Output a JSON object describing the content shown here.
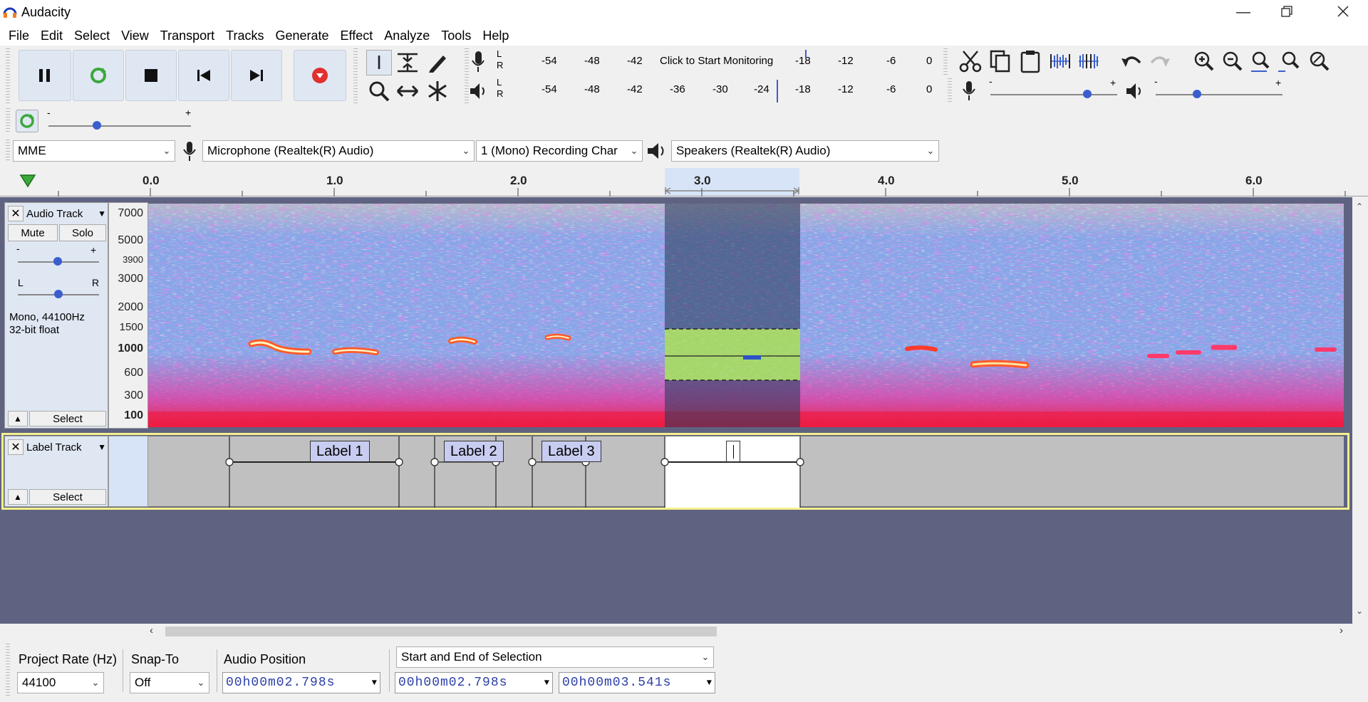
{
  "window": {
    "title": "Audacity"
  },
  "menu": [
    "File",
    "Edit",
    "Select",
    "View",
    "Transport",
    "Tracks",
    "Generate",
    "Effect",
    "Analyze",
    "Tools",
    "Help"
  ],
  "meters": {
    "record_ticks": [
      "-54",
      "-48",
      "-42",
      "Click to Start Monitoring",
      "-18",
      "-12",
      "-6",
      "0"
    ],
    "play_ticks": [
      "-54",
      "-48",
      "-42",
      "-36",
      "-30",
      "-24",
      "-18",
      "-12",
      "-6",
      "0"
    ],
    "channel_l": "L",
    "channel_r": "R"
  },
  "sliders": {
    "minus": "-",
    "plus": "+"
  },
  "device": {
    "host": "MME",
    "input": "Microphone (Realtek(R) Audio)",
    "channels": "1 (Mono) Recording Char",
    "output": "Speakers (Realtek(R) Audio)"
  },
  "ruler": {
    "ticks": [
      "0.0",
      "1.0",
      "2.0",
      "3.0",
      "4.0",
      "5.0",
      "6.0"
    ]
  },
  "audio_track": {
    "name": "Audio Track",
    "mute": "Mute",
    "solo": "Solo",
    "pan_l": "L",
    "pan_r": "R",
    "info1": "Mono, 44100Hz",
    "info2": "32-bit float",
    "select": "Select",
    "freq_labels": [
      "7000",
      "5000",
      "3900",
      "3000",
      "2000",
      "1500",
      "1000",
      "600",
      "300",
      "100"
    ]
  },
  "label_track": {
    "name": "Label Track",
    "select": "Select",
    "labels": [
      "Label 1",
      "Label 2",
      "Label 3"
    ]
  },
  "selection_bar": {
    "project_rate_label": "Project Rate (Hz)",
    "project_rate": "44100",
    "snap_label": "Snap-To",
    "snap_value": "Off",
    "audio_position_label": "Audio Position",
    "audio_position": "00h00m02.798s",
    "selection_mode": "Start and End of Selection",
    "sel_start": "00h00m02.798s",
    "sel_end": "00h00m03.541s"
  },
  "colors": {
    "accent": "#3a5fcd",
    "selection": "#d7e4f7",
    "track_bg": "#5f6381",
    "label_fill": "#c8ccf0"
  }
}
